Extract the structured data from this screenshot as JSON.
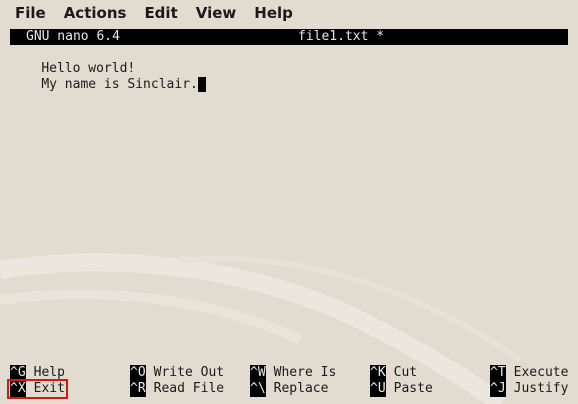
{
  "menubar": {
    "items": [
      "File",
      "Actions",
      "Edit",
      "View",
      "Help"
    ]
  },
  "nano": {
    "version": "GNU nano 6.4",
    "filename": "file1.txt *",
    "lines": [
      "Hello world!",
      "My name is Sinclair."
    ]
  },
  "shortcuts": {
    "row1": [
      {
        "key": "^G",
        "label": "Help"
      },
      {
        "key": "^O",
        "label": "Write Out"
      },
      {
        "key": "^W",
        "label": "Where Is"
      },
      {
        "key": "^K",
        "label": "Cut"
      },
      {
        "key": "^T",
        "label": "Execute"
      }
    ],
    "row2": [
      {
        "key": "^X",
        "label": "Exit"
      },
      {
        "key": "^R",
        "label": "Read File"
      },
      {
        "key": "^\\",
        "label": "Replace"
      },
      {
        "key": "^U",
        "label": "Paste"
      },
      {
        "key": "^J",
        "label": "Justify"
      }
    ]
  },
  "colors": {
    "background": "#e2dbd0",
    "terminal_fg": "#1a1a1a",
    "highlight": "#d11a1a"
  }
}
